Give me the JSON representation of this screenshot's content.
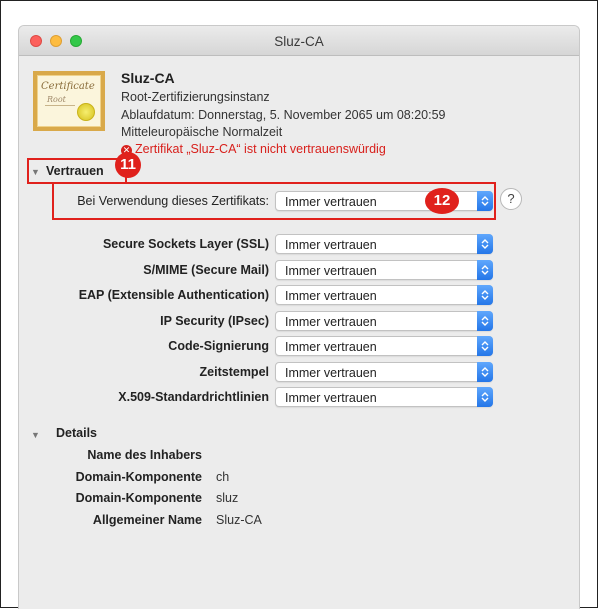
{
  "window": {
    "title": "Sluz-CA"
  },
  "certificate": {
    "icon_text": "Certificate",
    "icon_subtext": "Root",
    "name": "Sluz-CA",
    "type": "Root-Zertifizierungsinstanz",
    "expiry_line1": "Ablaufdatum: Donnerstag, 5. November 2065 um 08:20:59",
    "expiry_line2": "Mitteleuropäische Normalzeit",
    "warning": "Zertifikat „Sluz-CA“ ist nicht vertrauenswürdig"
  },
  "trust": {
    "section_title": "Vertrauen",
    "badge": "11",
    "main_label": "Bei Verwendung dieses Zertifikats:",
    "main_value": "Immer vertrauen",
    "main_badge": "12",
    "help": "?",
    "rows": [
      {
        "label": "Secure Sockets Layer (SSL)",
        "value": "Immer vertrauen"
      },
      {
        "label": "S/MIME (Secure Mail)",
        "value": "Immer vertrauen"
      },
      {
        "label": "EAP (Extensible Authentication)",
        "value": "Immer vertrauen"
      },
      {
        "label": "IP Security (IPsec)",
        "value": "Immer vertrauen"
      },
      {
        "label": "Code-Signierung",
        "value": "Immer vertrauen"
      },
      {
        "label": "Zeitstempel",
        "value": "Immer vertrauen"
      },
      {
        "label": "X.509-Standardrichtlinien",
        "value": "Immer vertrauen"
      }
    ]
  },
  "details": {
    "section_title": "Details",
    "rows": [
      {
        "label": "Name des Inhabers",
        "value": ""
      },
      {
        "label": "Domain-Komponente",
        "value": "ch"
      },
      {
        "label": "Domain-Komponente",
        "value": "sluz"
      },
      {
        "label": "Allgemeiner Name",
        "value": "Sluz-CA"
      }
    ]
  },
  "colors": {
    "warning": "#d8201c",
    "highlight": "#e0211c",
    "accent": "#2476e8"
  }
}
